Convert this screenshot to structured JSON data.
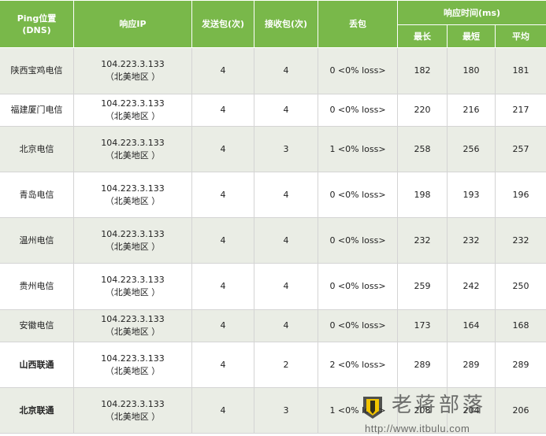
{
  "header": {
    "location_line1": "Ping位置",
    "location_line2": "(DNS)",
    "ip": "响应IP",
    "sent": "发送包(次)",
    "received": "接收包(次)",
    "loss": "丢包",
    "response_time": "响应时间(ms)",
    "max": "最长",
    "min": "最短",
    "avg": "平均"
  },
  "rows": [
    {
      "location": "陕西宝鸡电信",
      "ip": "104.223.3.133",
      "region": "（北美地区 ）",
      "sent": "4",
      "received": "4",
      "loss": "0 <0% loss>",
      "max": "182",
      "min": "180",
      "avg": "181"
    },
    {
      "location": "福建厦门电信",
      "ip": "104.223.3.133",
      "region": "（北美地区 ）",
      "sent": "4",
      "received": "4",
      "loss": "0 <0% loss>",
      "max": "220",
      "min": "216",
      "avg": "217"
    },
    {
      "location": "北京电信",
      "ip": "104.223.3.133",
      "region": "（北美地区 ）",
      "sent": "4",
      "received": "3",
      "loss": "1 <0% loss>",
      "max": "258",
      "min": "256",
      "avg": "257"
    },
    {
      "location": "青岛电信",
      "ip": "104.223.3.133",
      "region": "（北美地区 ）",
      "sent": "4",
      "received": "4",
      "loss": "0 <0% loss>",
      "max": "198",
      "min": "193",
      "avg": "196"
    },
    {
      "location": "温州电信",
      "ip": "104.223.3.133",
      "region": "（北美地区 ）",
      "sent": "4",
      "received": "4",
      "loss": "0 <0% loss>",
      "max": "232",
      "min": "232",
      "avg": "232"
    },
    {
      "location": "贵州电信",
      "ip": "104.223.3.133",
      "region": "（北美地区 ）",
      "sent": "4",
      "received": "4",
      "loss": "0 <0% loss>",
      "max": "259",
      "min": "242",
      "avg": "250"
    },
    {
      "location": "安徽电信",
      "ip": "104.223.3.133",
      "region": "（北美地区 ）",
      "sent": "4",
      "received": "4",
      "loss": "0 <0% loss>",
      "max": "173",
      "min": "164",
      "avg": "168"
    },
    {
      "location": "山西联通",
      "ip": "104.223.3.133",
      "region": "（北美地区 ）",
      "sent": "4",
      "received": "2",
      "loss": "2 <0% loss>",
      "max": "289",
      "min": "289",
      "avg": "289"
    },
    {
      "location": "北京联通",
      "ip": "104.223.3.133",
      "region": "（北美地区 ）",
      "sent": "4",
      "received": "3",
      "loss": "1 <0% loss>",
      "max": "208",
      "min": "204",
      "avg": "206"
    }
  ],
  "watermark": {
    "title": "老蒋部落",
    "url": "http://www.itbulu.com",
    "logo_icon": "pencil-badge-icon"
  },
  "colors": {
    "header_bg": "#79b84a",
    "row_alt_bg": "#eaede5"
  }
}
